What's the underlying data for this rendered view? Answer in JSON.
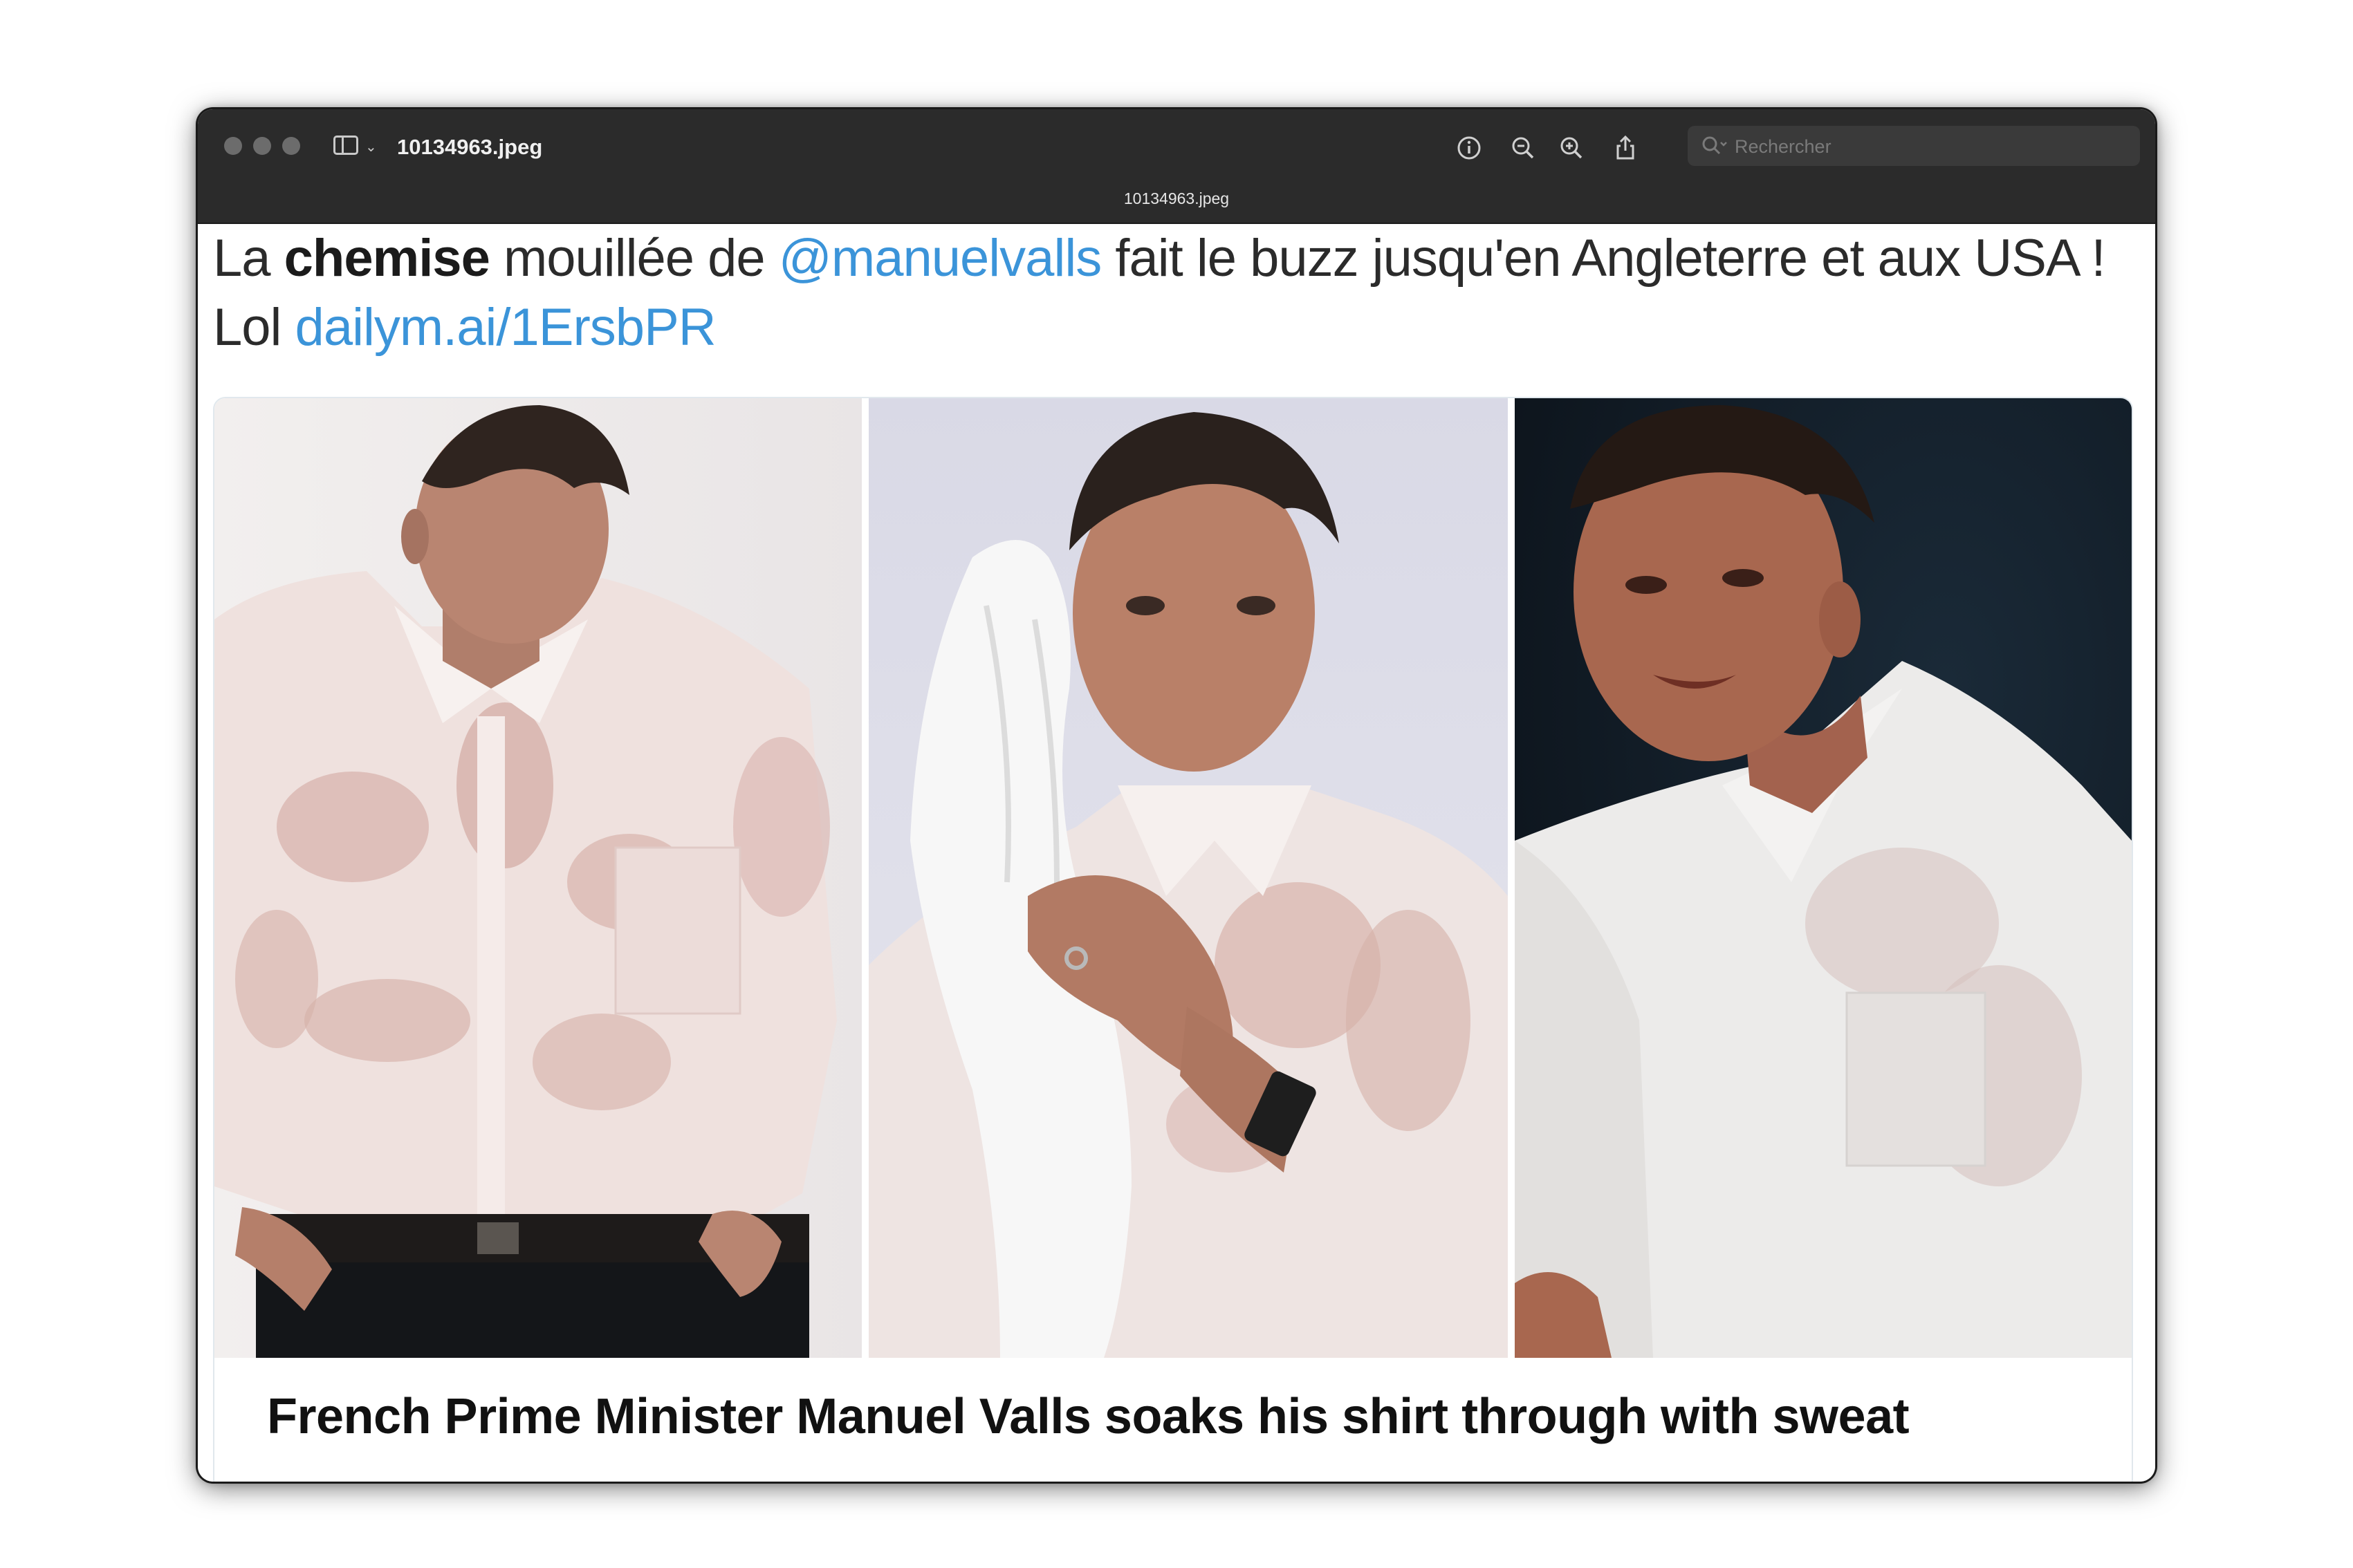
{
  "window": {
    "title": "10134963.jpeg",
    "document_title": "10134963.jpeg"
  },
  "toolbar": {
    "icons": [
      "info-icon",
      "zoom-out-icon",
      "zoom-in-icon",
      "share-icon",
      "markup-pen-icon",
      "markup-chevron-icon",
      "rotate-icon",
      "annotate-icon"
    ]
  },
  "search": {
    "placeholder": "Rechercher",
    "value": ""
  },
  "tweet": {
    "w1": "La ",
    "w2_bold": "chemise",
    "w3": " mouillée de ",
    "mention": "@manuelvalls",
    "w4": " fait le buzz jusqu'en Angleterre et aux USA !",
    "w5": "Lol ",
    "link": "dailym.ai/1ErsbPR"
  },
  "card": {
    "headline": "French Prime Minister Manuel Valls soaks his shirt through with sweat"
  },
  "colors": {
    "titlebar": "#2b2b2b",
    "link": "#3b94d9",
    "text": "#2b2b2b"
  }
}
